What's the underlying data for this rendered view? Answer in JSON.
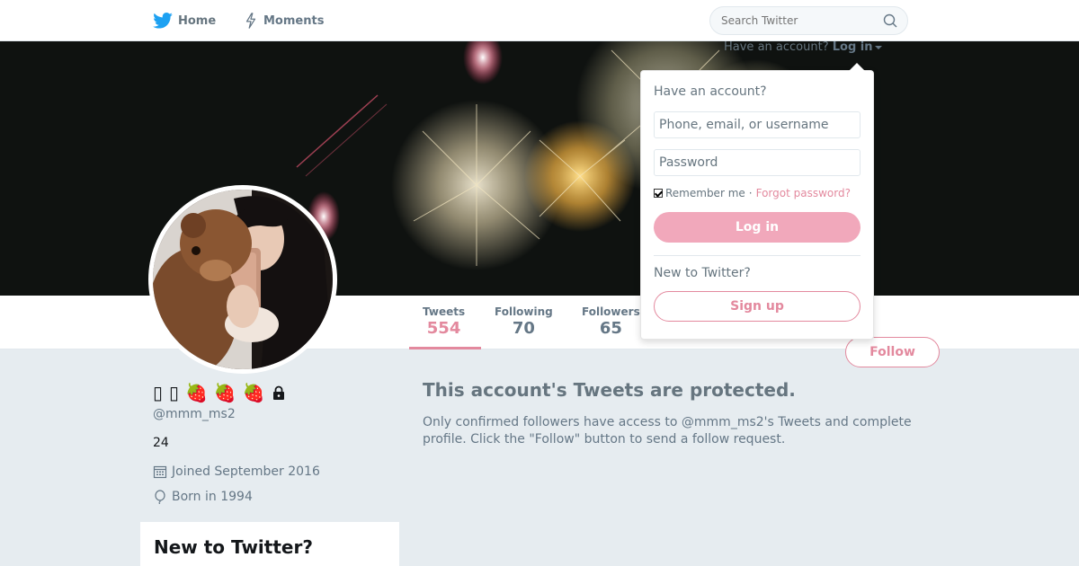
{
  "nav": {
    "home_label": "Home",
    "moments_label": "Moments",
    "search_placeholder": "Search Twitter"
  },
  "login_link": {
    "prefix": "Have an account?",
    "label": "Log in"
  },
  "profile": {
    "name": "🍓 🍓 🍓",
    "name_prefix": "▯ ▯",
    "handle": "@mmm_ms2",
    "bio": "24",
    "joined": "Joined September 2016",
    "born": "Born in 1994"
  },
  "stats": [
    {
      "label": "Tweets",
      "value": "554"
    },
    {
      "label": "Following",
      "value": "70"
    },
    {
      "label": "Followers",
      "value": "65"
    }
  ],
  "follow_label": "Follow",
  "protected": {
    "title": "This account's Tweets are protected.",
    "body": "Only confirmed followers have access to @mmm_ms2's Tweets and complete profile. Click the \"Follow\" button to send a follow request."
  },
  "new_card": {
    "title": "New to Twitter?"
  },
  "login_dropdown": {
    "heading": "Have an account?",
    "username_placeholder": "Phone, email, or username",
    "password_placeholder": "Password",
    "remember_label": "Remember me",
    "separator": "·",
    "forgot_label": "Forgot password?",
    "login_button": "Log in",
    "new_heading": "New to Twitter?",
    "signup_button": "Sign up"
  },
  "colors": {
    "accent": "#e3899e",
    "accent_light": "#f1a8bb",
    "twitter_blue": "#1da1f2"
  }
}
